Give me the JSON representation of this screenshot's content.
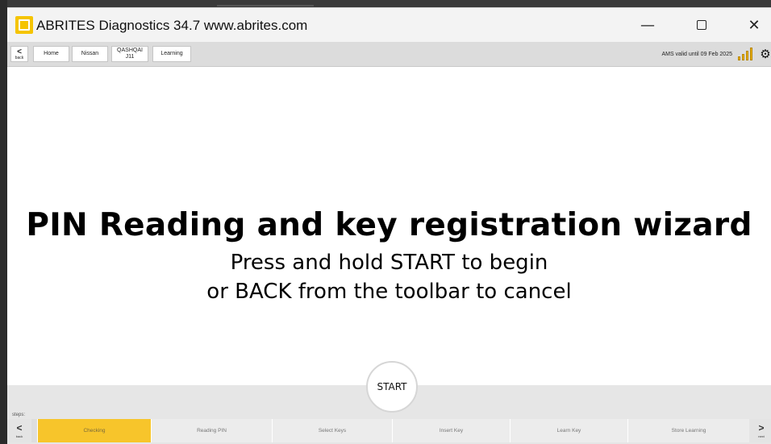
{
  "window": {
    "title": "ABRITES Diagnostics 34.7   www.abrites.com",
    "controls": {
      "minimize": "—",
      "close": "✕"
    }
  },
  "toolbar": {
    "back_chevron": "<",
    "back_label": "back",
    "breadcrumbs": [
      "Home",
      "Nissan",
      "QASHQAI\nJ11",
      "Learning"
    ],
    "ams_status": "AMS valid until 09 Feb 2025",
    "signal_level": 4,
    "gear_glyph": "⚙"
  },
  "main": {
    "headline": "PIN Reading and key registration wizard",
    "line1": "Press and hold START to begin",
    "line2": "or BACK from the toolbar to cancel"
  },
  "footer": {
    "start_label": "START",
    "steps_label": "steps:",
    "back_chevron": "<",
    "back_label": "back",
    "next_chevron": ">",
    "next_label": "next",
    "steps": [
      "Checking",
      "Reading PIN",
      "Select Keys",
      "Insert Key",
      "Learn Key",
      "Store Learning"
    ],
    "active_step": 0
  },
  "colors": {
    "accent_yellow": "#f7c52b",
    "toolbar_bg": "#dcdcdc",
    "titlebar_bg": "#f3f3f3"
  }
}
